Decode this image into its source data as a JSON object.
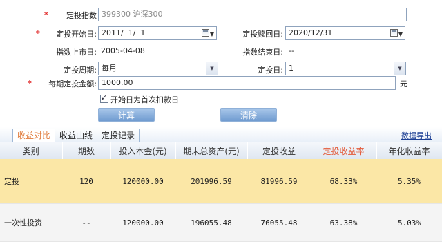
{
  "form": {
    "index": {
      "label": "定投指数",
      "placeholder": "399300 沪深300"
    },
    "start_date": {
      "label": "定投开始日:",
      "value": "2011/  1/  1"
    },
    "redeem_date": {
      "label": "定投赎回日:",
      "value": "2020/12/31"
    },
    "list_date": {
      "label": "指数上市日:",
      "value": "2005-04-08"
    },
    "end_date": {
      "label": "指数结束日:",
      "value": "--"
    },
    "period": {
      "label": "定投周期:",
      "value": "每月"
    },
    "invest_day": {
      "label": "定投日:",
      "value": "1"
    },
    "amount": {
      "label": "每期定投金额:",
      "value": "1000.00",
      "unit": "元"
    },
    "first_deduct": {
      "label": "开始日为首次扣款日",
      "checked": true
    },
    "required_mark": "*"
  },
  "buttons": {
    "calculate": "计算",
    "clear": "清除"
  },
  "tabs": [
    "收益对比",
    "收益曲线",
    "定投记录"
  ],
  "export_link": "数据导出",
  "table": {
    "headers": [
      "类别",
      "期数",
      "投入本金(元)",
      "期末总资产(元)",
      "定投收益",
      "定投收益率",
      "年化收益率"
    ],
    "rows": [
      [
        "定投",
        "120",
        "120000.00",
        "201996.59",
        "81996.59",
        "68.33%",
        "5.35%"
      ],
      [
        "一次性投资",
        "--",
        "120000.00",
        "196055.48",
        "76055.48",
        "63.38%",
        "5.03%"
      ]
    ]
  },
  "colors": {
    "accent": "#e07a3a",
    "highlight_row": "#fbe7a6",
    "link": "#1c3f94",
    "required": "#e02020"
  }
}
